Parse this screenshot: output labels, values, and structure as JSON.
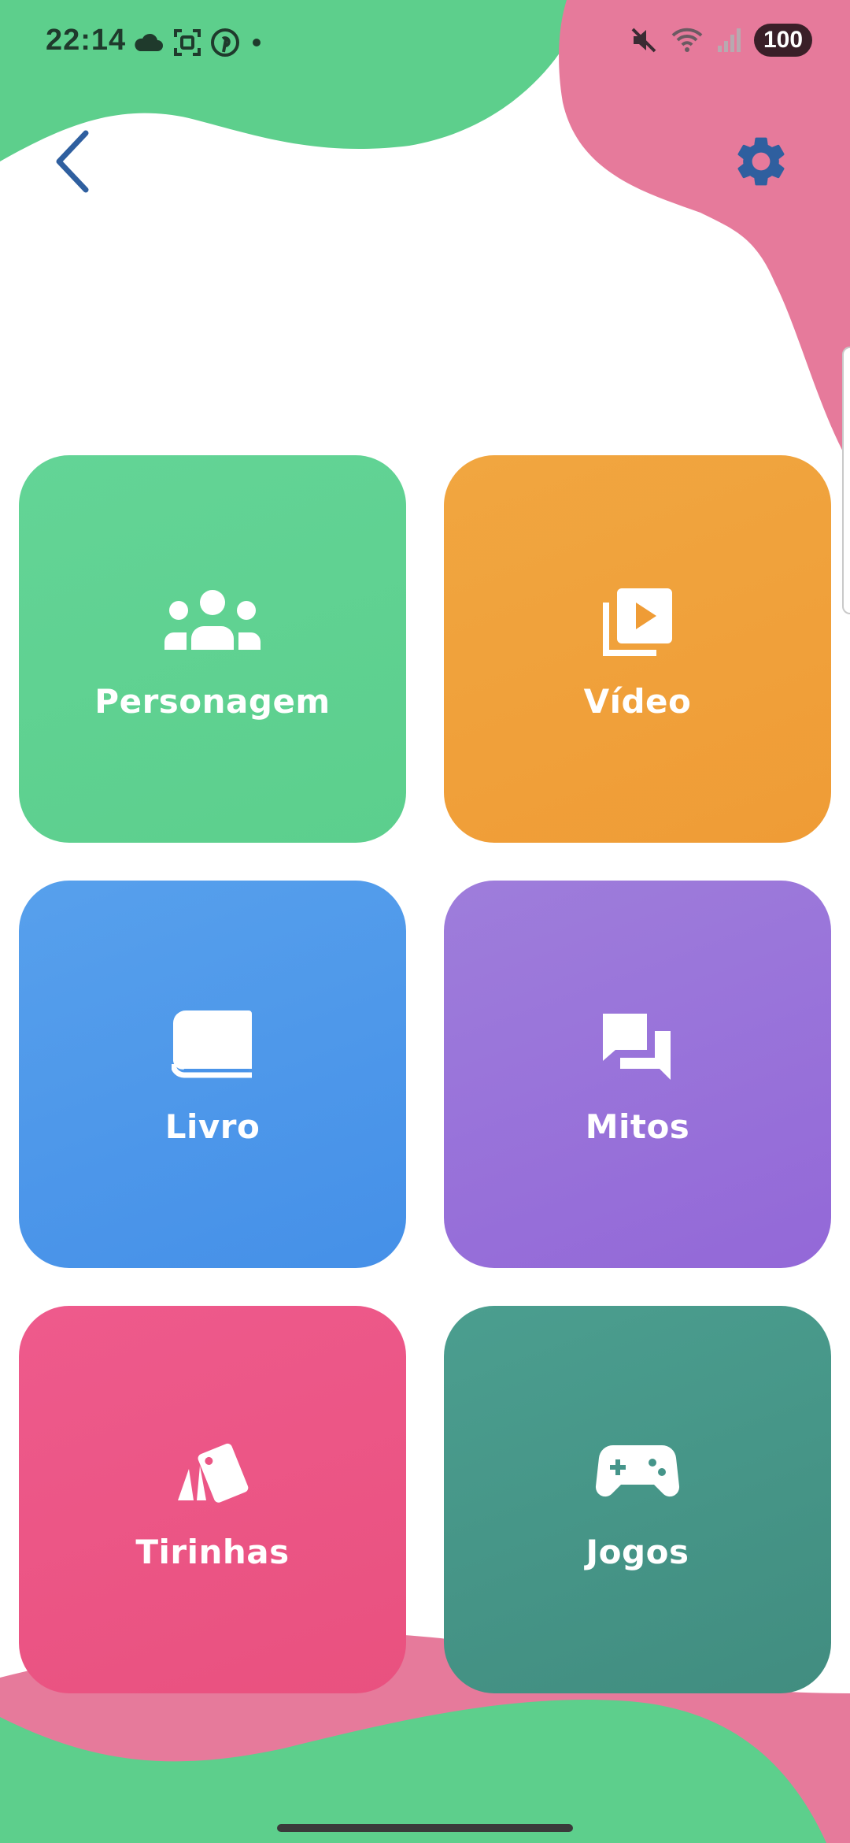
{
  "status_bar": {
    "time": "22:14",
    "left_icons": [
      "cloud-icon",
      "screen-capture-icon",
      "pinterest-icon",
      "dot-icon"
    ],
    "right_icons": [
      "mute-icon",
      "wifi-icon",
      "signal-icon"
    ],
    "battery": "100"
  },
  "nav": {
    "back_icon": "chevron-left-icon",
    "settings_icon": "gear-icon",
    "accent_color": "#2f5f9f"
  },
  "tiles": [
    {
      "label": "Personagem",
      "icon": "group-icon",
      "color": "#5ccf8d"
    },
    {
      "label": "Vídeo",
      "icon": "video-library-icon",
      "color": "#ef9c36"
    },
    {
      "label": "Livro",
      "icon": "book-icon",
      "color": "#4a94e9"
    },
    {
      "label": "Mitos",
      "icon": "chat-bubbles-icon",
      "color": "#9670d9"
    },
    {
      "label": "Tirinhas",
      "icon": "cards-icon",
      "color": "#eb5584"
    },
    {
      "label": "Jogos",
      "icon": "gamepad-icon",
      "color": "#45958a"
    }
  ],
  "background": {
    "blob_green": "#5dcf8c",
    "blob_pink": "#e67a9b"
  }
}
